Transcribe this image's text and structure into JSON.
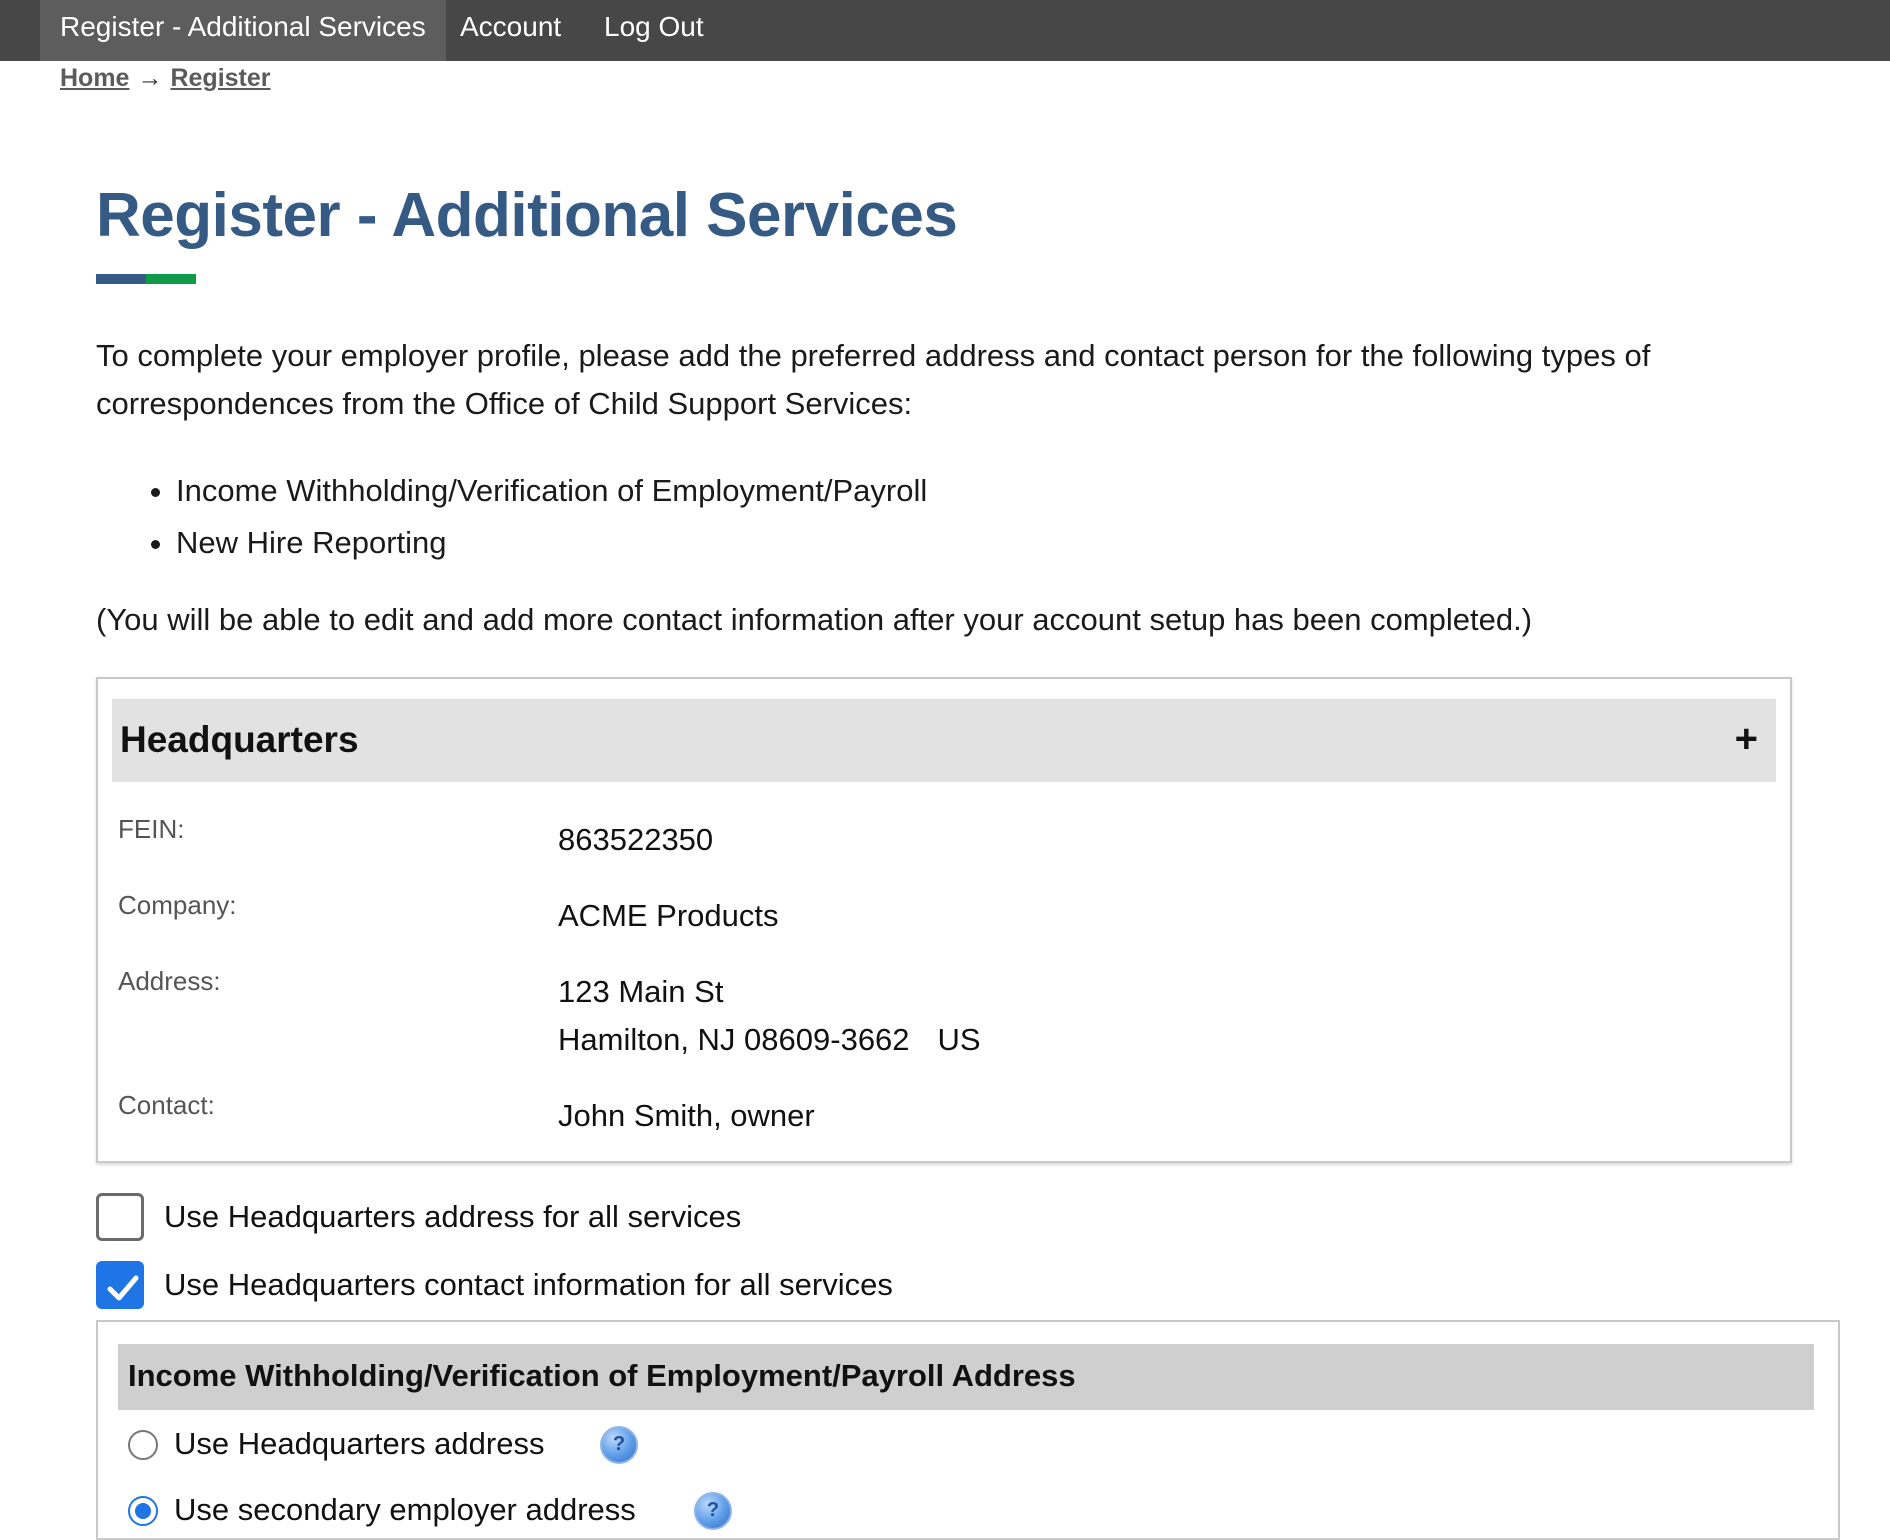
{
  "nav": {
    "items": [
      {
        "label": "Register - Additional Services",
        "active": true
      },
      {
        "label": "Account",
        "active": false
      },
      {
        "label": "Log Out",
        "active": false
      }
    ]
  },
  "breadcrumb": {
    "home": "Home",
    "separator": "→",
    "current": "Register"
  },
  "page": {
    "title": "Register - Additional Services",
    "intro": "To complete your employer profile, please add the preferred address and contact person for the following types of correspondences from the Office of Child Support Services:",
    "services": [
      "Income Withholding/Verification of Employment/Payroll",
      "New Hire Reporting"
    ],
    "note": "(You will be able to edit and add more contact information after your account setup has been completed.)"
  },
  "headquarters": {
    "title": "Headquarters",
    "expand_symbol": "+",
    "fein_label": "FEIN:",
    "fein_value": "863522350",
    "company_label": "Company:",
    "company_value": "ACME Products",
    "address_label": "Address:",
    "address_line1": "123 Main St",
    "address_line2": "Hamilton, NJ 08609-3662",
    "address_country": "US",
    "contact_label": "Contact:",
    "contact_value": "John Smith, owner"
  },
  "options": {
    "use_hq_address_label": "Use Headquarters address for all services",
    "use_hq_address_checked": false,
    "use_hq_contact_label": "Use Headquarters contact information for all services",
    "use_hq_contact_checked": true
  },
  "income_section": {
    "title": "Income Withholding/Verification of Employment/Payroll Address",
    "radio_hq_label": "Use Headquarters address",
    "radio_secondary_label": "Use secondary employer address",
    "selected": "secondary",
    "help_symbol": "?"
  },
  "colors": {
    "nav_bg": "#474747",
    "title_blue": "#355b85",
    "accent_green": "#0e9a48",
    "checkbox_blue": "#1f74e6"
  }
}
